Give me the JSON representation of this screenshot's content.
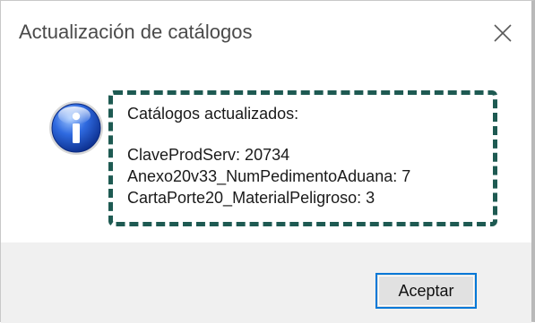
{
  "dialog": {
    "title": "Actualización de catálogos",
    "close_icon": "close-icon",
    "info_icon": "info-icon",
    "message": {
      "heading": "Catálogos actualizados:",
      "lines": [
        "ClaveProdServ: 20734",
        "Anexo20v33_NumPedimentoAduana: 7",
        "CartaPorte20_MaterialPeligroso: 3"
      ]
    },
    "ok_label": "Aceptar"
  },
  "colors": {
    "highlight_border": "#1e5a52",
    "button_focus": "#0078d7",
    "footer_bg": "#f0f0f0",
    "info_blue": "#1e4fc2"
  }
}
